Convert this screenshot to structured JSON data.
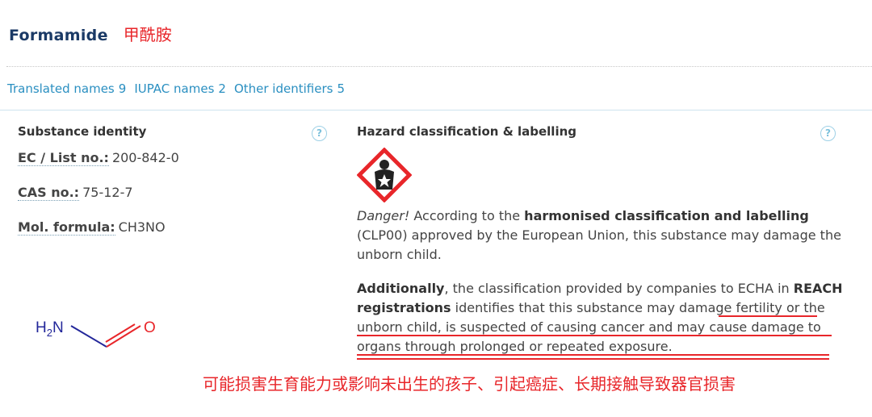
{
  "header": {
    "title_en": "Formamide",
    "title_cn": "甲酰胺"
  },
  "tabs": [
    {
      "label": "Translated names",
      "count": "9"
    },
    {
      "label": "IUPAC names",
      "count": "2"
    },
    {
      "label": "Other identifiers",
      "count": "5"
    }
  ],
  "identity": {
    "title": "Substance identity",
    "ec_label": "EC / List no.:",
    "ec_value": "200-842-0",
    "cas_label": "CAS no.:",
    "cas_value": "75-12-7",
    "formula_label": "Mol. formula:",
    "formula_value": "CH3NO",
    "structure": {
      "atom_n": "H2N",
      "atom_o": "O"
    }
  },
  "hazard": {
    "title": "Hazard classification & labelling",
    "pictogram": "health-hazard-icon",
    "p1": {
      "danger": "Danger!",
      "a": " According to the ",
      "bold": "harmonised classification and labelling",
      "b": " (CLP00) approved by the European Union, this substance may damage the unborn child."
    },
    "p2": {
      "bold1": "Additionally",
      "a": ", the classification provided by companies to ECHA in ",
      "bold2": "REACH registrations",
      "b": " identifies that this substance may damage fertility or the unborn child, is suspected of causing cancer and may cause damage to organs through prolonged or repeated exposure."
    }
  },
  "annotation_cn": "可能损害生育能力或影响未出生的孩子、引起癌症、长期接触导致器官损害",
  "colors": {
    "accent_red": "#e8262a",
    "link_blue": "#2a8fc1",
    "title_navy": "#1b3a66"
  }
}
